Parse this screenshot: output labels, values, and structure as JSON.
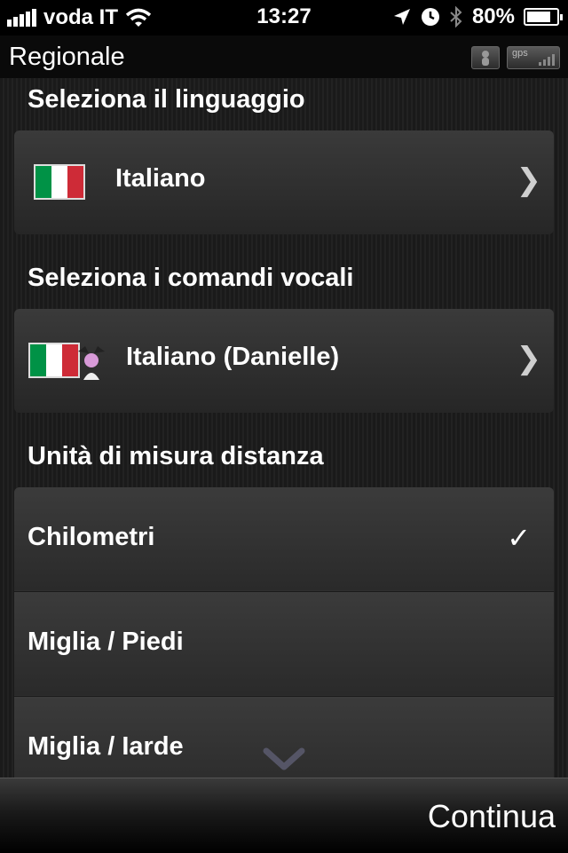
{
  "status_bar": {
    "carrier": "voda IT",
    "time": "13:27",
    "battery": "80%",
    "battery_level": 0.8,
    "icons": [
      "signal-icon",
      "wifi-icon",
      "location-icon",
      "clock-icon",
      "bluetooth-icon",
      "battery-icon"
    ]
  },
  "header": {
    "title": "Regionale",
    "gps_label": "gps"
  },
  "language": {
    "section_title": "Seleziona il linguaggio",
    "value": "Italiano"
  },
  "voice": {
    "section_title": "Seleziona i comandi vocali",
    "value": "Italiano (Danielle)"
  },
  "distance": {
    "section_title": "Unità di misura distanza",
    "options": [
      {
        "label": "Chilometri",
        "selected": true
      },
      {
        "label": "Miglia / Piedi",
        "selected": false
      },
      {
        "label": "Miglia / Iarde",
        "selected": false
      }
    ],
    "check_glyph": "✓"
  },
  "footer": {
    "continue_label": "Continua"
  },
  "colors": {
    "flag_green": "#009246",
    "flag_white": "#ffffff",
    "flag_red": "#ce2b37"
  }
}
